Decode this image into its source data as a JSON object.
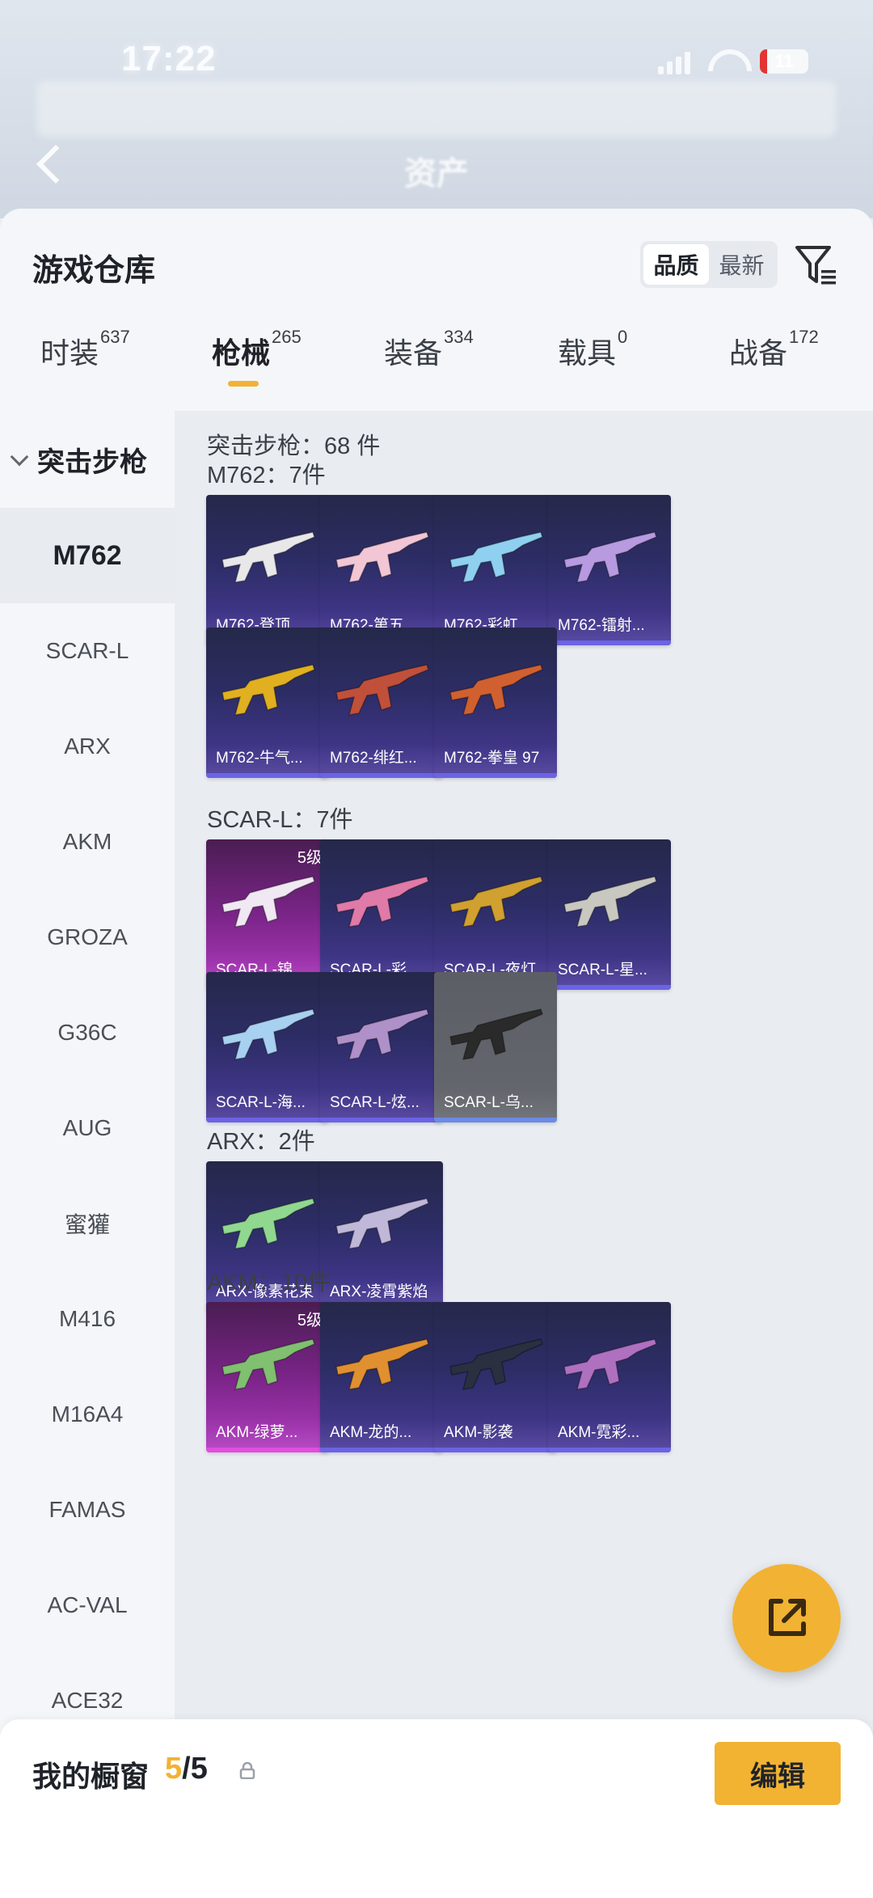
{
  "status_bar": {
    "time": "17:22",
    "battery": "11"
  },
  "top": {
    "title": "资产"
  },
  "header": {
    "title": "游戏仓库",
    "sort_options": [
      "品质",
      "最新"
    ],
    "sort_active": "品质"
  },
  "category_tabs": [
    {
      "label": "时装",
      "count": "637"
    },
    {
      "label": "枪械",
      "count": "265",
      "active": true
    },
    {
      "label": "装备",
      "count": "334"
    },
    {
      "label": "载具",
      "count": "0"
    },
    {
      "label": "战备",
      "count": "172"
    }
  ],
  "sidebar": {
    "category": "突击步枪",
    "items": [
      "M762",
      "SCAR-L",
      "ARX",
      "AKM",
      "GROZA",
      "G36C",
      "AUG",
      "蜜獾",
      "M416",
      "M16A4",
      "FAMAS",
      "AC-VAL",
      "ACE32"
    ],
    "active": "M762"
  },
  "content": {
    "total_label": "突击步枪：68 件",
    "groups": [
      {
        "label": "M762：7件",
        "items": [
          {
            "name": "M762-登顶...",
            "rarity": "purple",
            "color": "#e8e8ea"
          },
          {
            "name": "M762-第五...",
            "rarity": "purple",
            "color": "#f2c6d4"
          },
          {
            "name": "M762-彩虹...",
            "rarity": "purple",
            "color": "#8fd0f0"
          },
          {
            "name": "M762-镭射...",
            "rarity": "purple",
            "color": "#b79ae0"
          },
          {
            "name": "M762-牛气...",
            "rarity": "purple",
            "color": "#e0b020"
          },
          {
            "name": "M762-绯红...",
            "rarity": "purple",
            "color": "#c0503a"
          },
          {
            "name": "M762-拳皇 97",
            "rarity": "purple",
            "color": "#d06030"
          }
        ]
      },
      {
        "label": "SCAR-L：7件",
        "items": [
          {
            "name": "SCAR-L-锦...",
            "rarity": "pink",
            "level": "5级",
            "color": "#f0e8f2"
          },
          {
            "name": "SCAR-L-彩...",
            "rarity": "purple",
            "color": "#e07aa8"
          },
          {
            "name": "SCAR-L-夜灯",
            "rarity": "purple",
            "color": "#d0a030"
          },
          {
            "name": "SCAR-L-星...",
            "rarity": "purple",
            "color": "#c8c8c0"
          },
          {
            "name": "SCAR-L-海...",
            "rarity": "purple",
            "color": "#a8d0f0"
          },
          {
            "name": "SCAR-L-炫...",
            "rarity": "purple",
            "color": "#b090c8"
          },
          {
            "name": "SCAR-L-乌...",
            "rarity": "gray",
            "color": "#2a2a2a"
          }
        ]
      },
      {
        "label": "ARX：2件",
        "items": [
          {
            "name": "ARX-像素花束",
            "rarity": "purple",
            "color": "#90d890"
          },
          {
            "name": "ARX-凌霄紫焰",
            "rarity": "purple",
            "color": "#c0b8d8"
          }
        ]
      },
      {
        "label": "AKM：10件",
        "items": [
          {
            "name": "AKM-绿萝...",
            "rarity": "pink",
            "level": "5级",
            "color": "#80c070"
          },
          {
            "name": "AKM-龙的...",
            "rarity": "purple",
            "color": "#e09030"
          },
          {
            "name": "AKM-影袭",
            "rarity": "purple",
            "color": "#2a3040"
          },
          {
            "name": "AKM-霓彩...",
            "rarity": "purple",
            "color": "#b070c0"
          }
        ]
      }
    ]
  },
  "bottom": {
    "showcase_title": "我的橱窗",
    "showcase_used": "5",
    "showcase_slash": "/",
    "showcase_total": "5",
    "edit_label": "编辑"
  },
  "colors": {
    "accent": "#f2b232",
    "card_purple": "#2d2d66",
    "card_pink": "#b23bc0",
    "card_gray": "#666870"
  }
}
